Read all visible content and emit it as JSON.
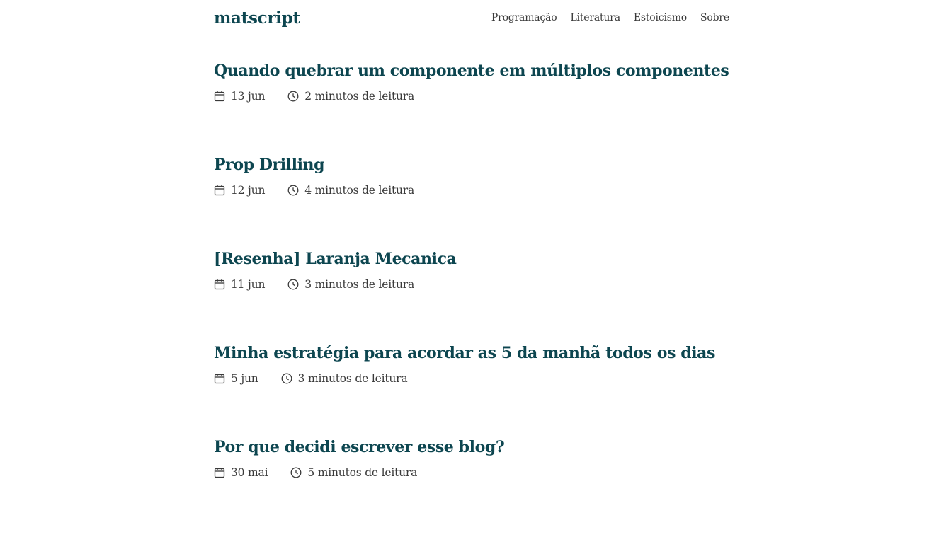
{
  "site": {
    "title": "matscript"
  },
  "nav": {
    "items": [
      {
        "label": "Programação"
      },
      {
        "label": "Literatura"
      },
      {
        "label": "Estoicismo"
      },
      {
        "label": "Sobre"
      }
    ]
  },
  "posts": [
    {
      "title": "Quando quebrar um componente em múltiplos componentes",
      "date": "13 jun",
      "reading_time": "2 minutos de leitura"
    },
    {
      "title": "Prop Drilling",
      "date": "12 jun",
      "reading_time": "4 minutos de leitura"
    },
    {
      "title": "[Resenha] Laranja Mecanica",
      "date": "11 jun",
      "reading_time": "3 minutos de leitura"
    },
    {
      "title": "Minha estratégia para acordar as 5 da manhã todos os dias",
      "date": "5 jun",
      "reading_time": "3 minutos de leitura"
    },
    {
      "title": "Por que decidi escrever esse blog?",
      "date": "30 mai",
      "reading_time": "5 minutos de leitura"
    }
  ],
  "icons": {
    "date": "calendar-icon",
    "reading_time": "clock-icon"
  },
  "colors": {
    "title": "#0d4650",
    "text": "#3a3a3a",
    "background": "#ffffff"
  }
}
